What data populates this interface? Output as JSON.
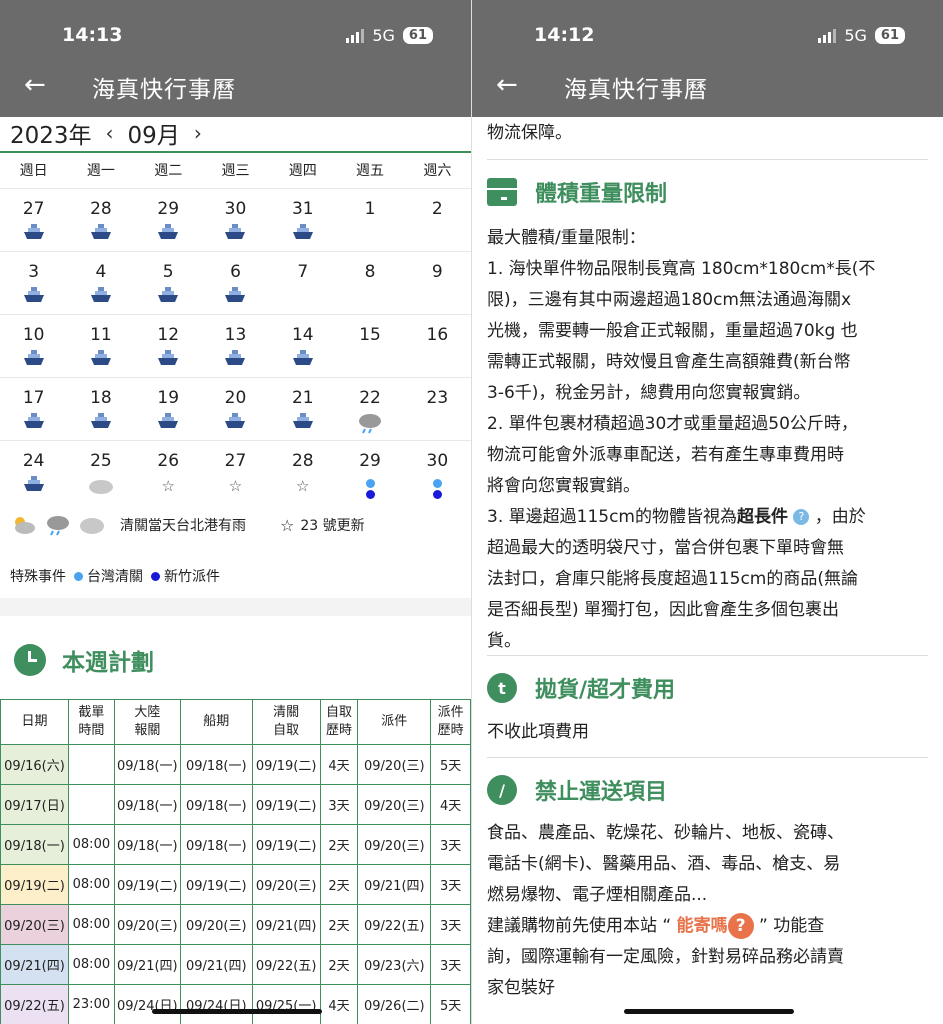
{
  "left": {
    "status_time": "14:13",
    "network": "5G",
    "battery": "61",
    "title": "海真快行事曆",
    "year": "2023年",
    "month": "09月",
    "weekdays": [
      "週日",
      "週一",
      "週二",
      "週三",
      "週四",
      "週五",
      "週六"
    ],
    "weeks": [
      [
        {
          "d": "27",
          "i": "ship"
        },
        {
          "d": "28",
          "i": "ship"
        },
        {
          "d": "29",
          "i": "ship"
        },
        {
          "d": "30",
          "i": "ship"
        },
        {
          "d": "31",
          "i": "ship"
        },
        {
          "d": "1",
          "i": ""
        },
        {
          "d": "2",
          "i": ""
        }
      ],
      [
        {
          "d": "3",
          "i": "ship"
        },
        {
          "d": "4",
          "i": "ship"
        },
        {
          "d": "5",
          "i": "ship"
        },
        {
          "d": "6",
          "i": "ship"
        },
        {
          "d": "7",
          "i": ""
        },
        {
          "d": "8",
          "i": ""
        },
        {
          "d": "9",
          "i": ""
        }
      ],
      [
        {
          "d": "10",
          "i": "ship"
        },
        {
          "d": "11",
          "i": "ship"
        },
        {
          "d": "12",
          "i": "ship"
        },
        {
          "d": "13",
          "i": "ship"
        },
        {
          "d": "14",
          "i": "ship"
        },
        {
          "d": "15",
          "i": ""
        },
        {
          "d": "16",
          "i": ""
        }
      ],
      [
        {
          "d": "17",
          "i": "ship"
        },
        {
          "d": "18",
          "i": "ship"
        },
        {
          "d": "19",
          "i": "ship"
        },
        {
          "d": "20",
          "i": "ship"
        },
        {
          "d": "21",
          "i": "ship"
        },
        {
          "d": "22",
          "i": "rain"
        },
        {
          "d": "23",
          "i": ""
        }
      ],
      [
        {
          "d": "24",
          "i": "ship"
        },
        {
          "d": "25",
          "i": "cloud"
        },
        {
          "d": "26",
          "i": "star"
        },
        {
          "d": "27",
          "i": "star"
        },
        {
          "d": "28",
          "i": "star"
        },
        {
          "d": "29",
          "i": "dots"
        },
        {
          "d": "30",
          "i": "dots"
        }
      ]
    ],
    "legend_weather": "清關當天台北港有雨",
    "legend_star": "23 號更新",
    "legend_special": "特殊事件",
    "legend_tw": "台灣清關",
    "legend_hc": "新竹派件",
    "plan_title": "本週計劃",
    "table_headers": [
      [
        "日期"
      ],
      [
        "截單",
        "時間"
      ],
      [
        "大陸",
        "報關"
      ],
      [
        "船期"
      ],
      [
        "清關",
        "自取"
      ],
      [
        "自取",
        "歷時"
      ],
      [
        "派件"
      ],
      [
        "派件",
        "歷時"
      ]
    ],
    "table_rows": [
      {
        "bg": "#e5efd9",
        "cells": [
          "09/16(六)",
          "",
          "09/18(一)",
          "09/18(一)",
          "09/19(二)",
          "4天",
          "09/20(三)",
          "5天"
        ]
      },
      {
        "bg": "#e5efd9",
        "cells": [
          "09/17(日)",
          "",
          "09/18(一)",
          "09/18(一)",
          "09/19(二)",
          "3天",
          "09/20(三)",
          "4天"
        ]
      },
      {
        "bg": "#e5efd9",
        "cells": [
          "09/18(一)",
          "08:00",
          "09/18(一)",
          "09/18(一)",
          "09/19(二)",
          "2天",
          "09/20(三)",
          "3天"
        ]
      },
      {
        "bg": "#fcefc9",
        "cells": [
          "09/19(二)",
          "08:00",
          "09/19(二)",
          "09/19(二)",
          "09/20(三)",
          "2天",
          "09/21(四)",
          "3天"
        ]
      },
      {
        "bg": "#ead1dc",
        "cells": [
          "09/20(三)",
          "08:00",
          "09/20(三)",
          "09/20(三)",
          "09/21(四)",
          "2天",
          "09/22(五)",
          "3天"
        ]
      },
      {
        "bg": "#d3e1f1",
        "cells": [
          "09/21(四)",
          "08:00",
          "09/21(四)",
          "09/21(四)",
          "09/22(五)",
          "2天",
          "09/23(六)",
          "3天"
        ]
      },
      {
        "bg": "#ebe1f3",
        "cells": [
          "09/22(五)",
          "23:00",
          "09/24(日)",
          "09/24(日)",
          "09/25(一)",
          "4天",
          "09/26(二)",
          "5天"
        ]
      }
    ]
  },
  "right": {
    "status_time": "14:12",
    "network": "5G",
    "battery": "61",
    "title": "海真快行事曆",
    "intro_tail": "物流保障。",
    "sec1_title": "體積重量限制",
    "sec1_lines": [
      "最大體積/重量限制：",
      "1. 海快單件物品限制長寬高 180cm*180cm*長(不",
      "限)，三邊有其中兩邊超過180cm無法通過海關x",
      "光機，需要轉一般倉正式報關，重量超過70kg 也",
      "需轉正式報關，時效慢且會產生高額雜費(新台幣",
      "3-6千)，稅金另計，總費用向您實報實銷。",
      "2. 單件包裹材積超過30才或重量超過50公斤時，",
      "物流可能會外派專車配送，若有產生專車費用時",
      "將會向您實報實銷。"
    ],
    "sec1_p3_prefix": "3. 單邊超過115cm的物體皆視為",
    "sec1_p3_bold": "超長件",
    "sec1_p3_suffix": " ，由於",
    "sec1_lines2": [
      "超過最大的透明袋尺寸，當合併包裹下單時會無",
      "法封口，倉庫只能將長度超過115cm的商品(無論",
      "是否細長型) 單獨打包，因此會產生多個包裹出",
      "貨。"
    ],
    "sec2_title": "拋貨/超才費用",
    "sec2_text": "不收此項費用",
    "sec3_title": "禁止運送項目",
    "sec3_lines": [
      "食品、農產品、乾燥花、砂輪片、地板、瓷磚、",
      "電話卡(網卡)、醫藥用品、酒、毒品、槍支、易",
      "燃易爆物、電子煙相關產品..."
    ],
    "sec3_link_prefix": "建議購物前先使用本站 “ ",
    "sec3_link": "能寄嗎",
    "sec3_link_suffix": " ” 功能查",
    "sec3_lines2": [
      "詢，國際運輸有一定風險，針對易碎品務必請賣",
      "家包裝好"
    ]
  },
  "colors": {
    "accent": "#3e8e5e",
    "light_dot": "#4aa3f0",
    "dark_dot": "#1a1ad8",
    "link": "#e8734a"
  }
}
